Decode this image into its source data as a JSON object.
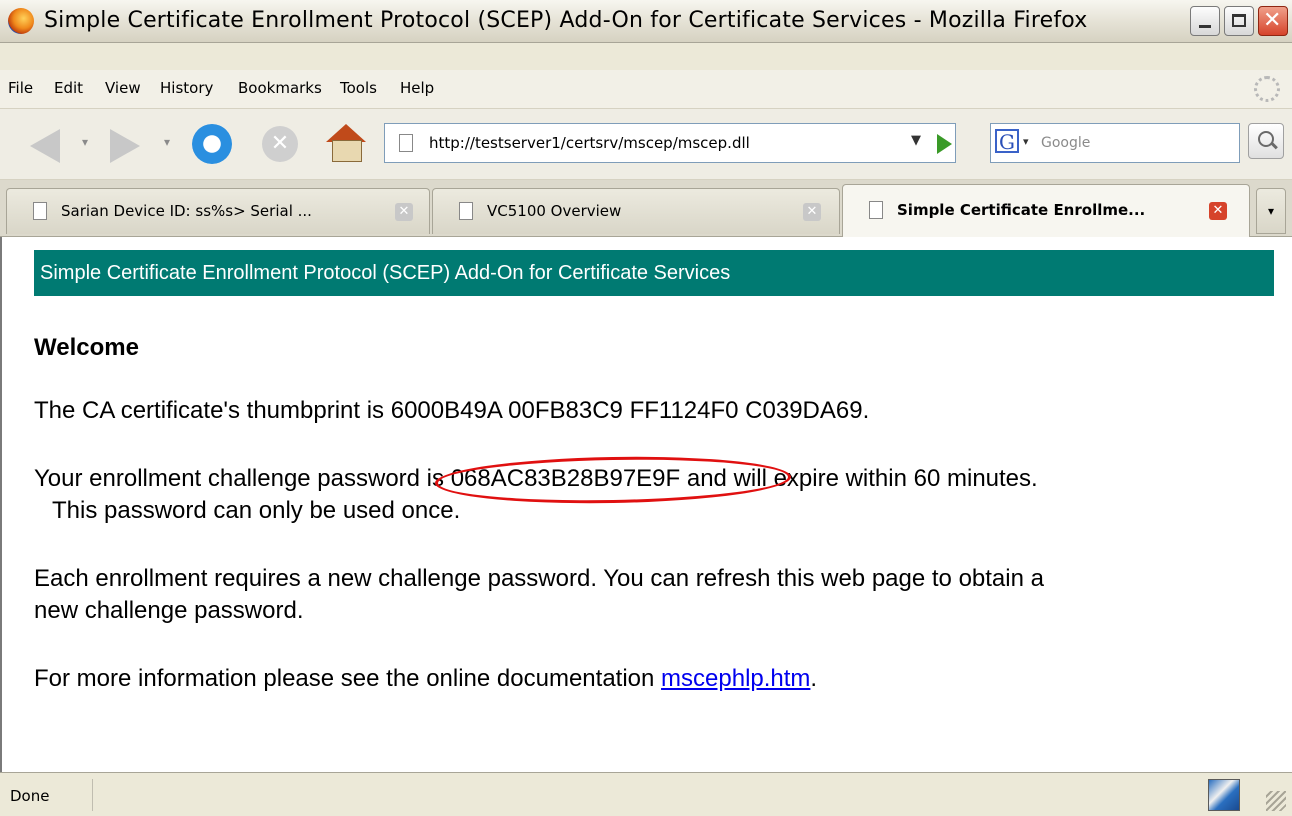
{
  "window": {
    "title": "Simple Certificate Enrollment Protocol (SCEP) Add-On for Certificate Services - Mozilla Firefox"
  },
  "menu": {
    "items": [
      "File",
      "Edit",
      "View",
      "History",
      "Bookmarks",
      "Tools",
      "Help"
    ]
  },
  "nav": {
    "url": "http://testserver1/certsrv/mscep/mscep.dll",
    "search_placeholder": "Google",
    "search_engine_letter": "G"
  },
  "tabs": [
    {
      "label": "Sarian Device ID: ss%s> Serial ...",
      "active": false
    },
    {
      "label": "VC5100 Overview",
      "active": false
    },
    {
      "label": "Simple Certificate Enrollme...",
      "active": true
    }
  ],
  "page": {
    "banner": "Simple Certificate Enrollment Protocol (SCEP) Add-On for Certificate Services",
    "heading": "Welcome",
    "thumbprint_text": "The CA certificate's thumbprint is 6000B49A 00FB83C9 FF1124F0 C039DA69.",
    "password_prefix": "Your enrollment challenge password is ",
    "password_value": "068AC83B28B97E9F",
    "password_suffix": " and will expire within 60 minutes.",
    "password_line2": "This password can only be used once.",
    "each_line1": "Each enrollment requires a new challenge password.   You can refresh this web page to obtain a",
    "each_line2": "new challenge password.",
    "more_prefix": "For more information please see the online documentation ",
    "more_link": "mscephlp.htm",
    "more_suffix": "."
  },
  "status": {
    "text": "Done"
  },
  "colors": {
    "banner_bg": "#007a72",
    "highlight_ellipse": "#e01010",
    "link": "#0000ee"
  }
}
